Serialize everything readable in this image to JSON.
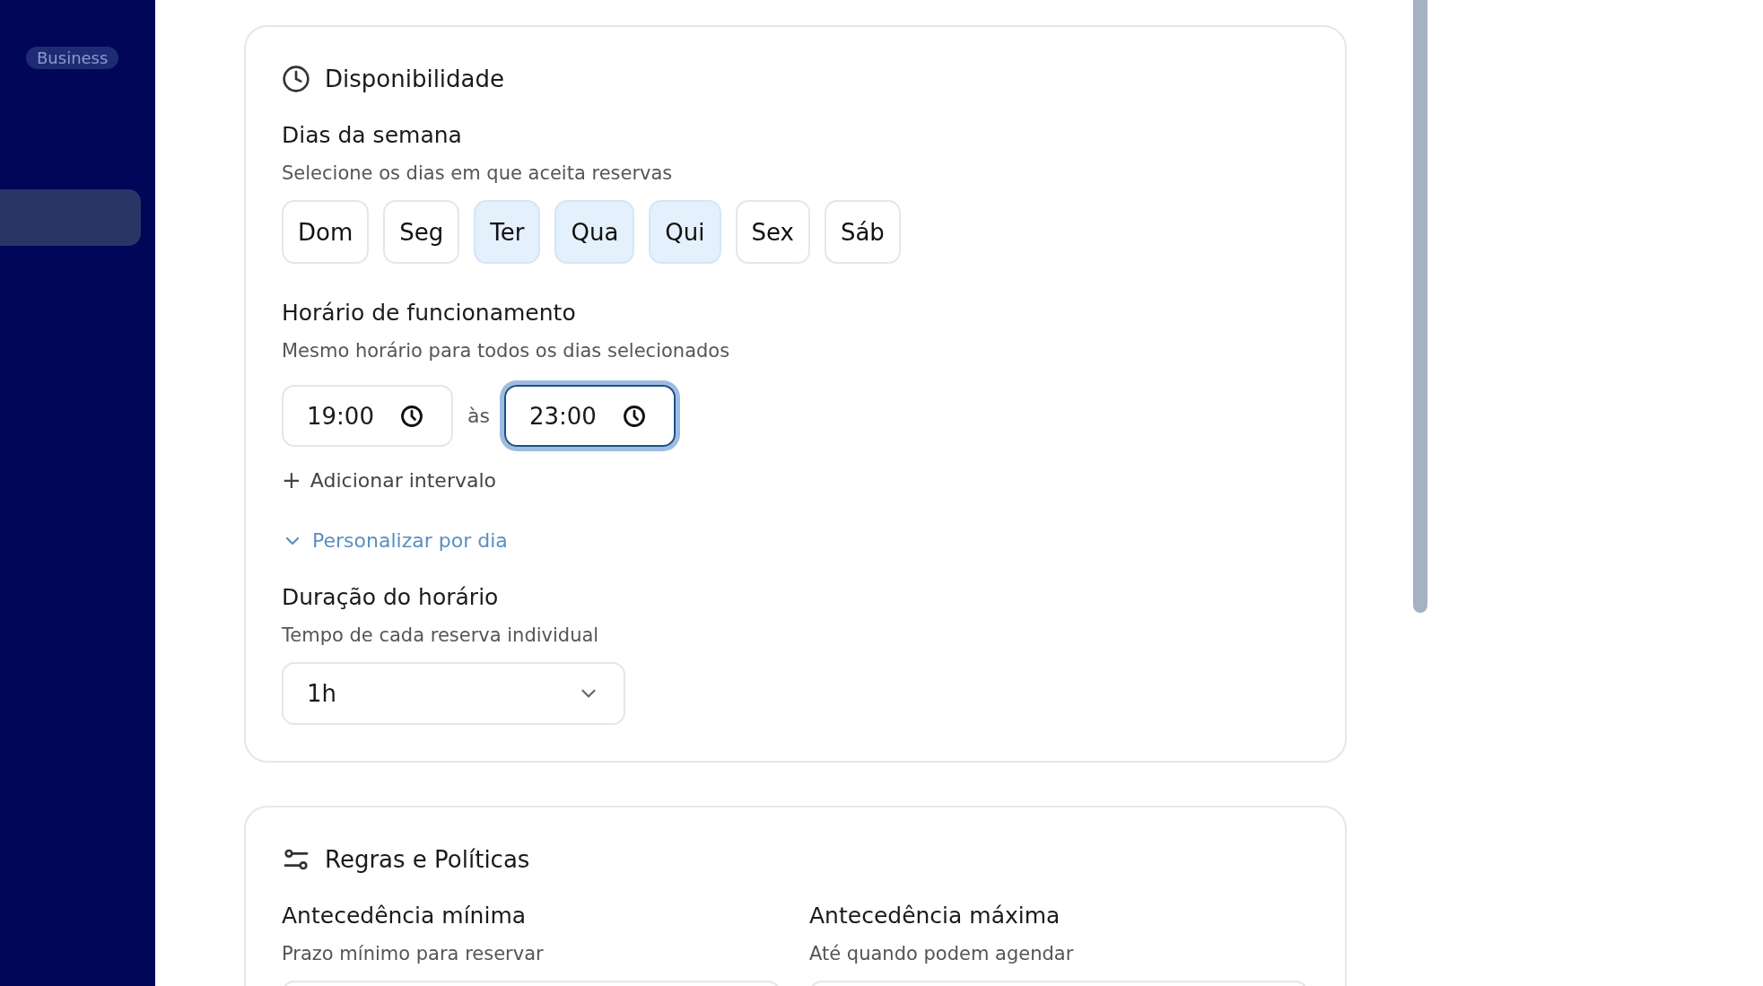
{
  "sidebar": {
    "badge": "Business"
  },
  "availability": {
    "title": "Disponibilidade",
    "days": {
      "label": "Dias da semana",
      "hint": "Selecione os dias em que aceita reservas",
      "items": [
        {
          "label": "Dom",
          "selected": false
        },
        {
          "label": "Seg",
          "selected": false
        },
        {
          "label": "Ter",
          "selected": true
        },
        {
          "label": "Qua",
          "selected": true
        },
        {
          "label": "Qui",
          "selected": true
        },
        {
          "label": "Sex",
          "selected": false
        },
        {
          "label": "Sáb",
          "selected": false
        }
      ]
    },
    "hours": {
      "label": "Horário de funcionamento",
      "hint": "Mesmo horário para todos os dias selecionados",
      "start": {
        "value": "19:00",
        "focused": false
      },
      "separator": "às",
      "end": {
        "value": "23:00",
        "focused": true
      }
    },
    "add_interval": {
      "icon": "+",
      "label": "Adicionar intervalo"
    },
    "customize": {
      "label": "Personalizar por dia",
      "expanded": false
    },
    "duration": {
      "label": "Duração do horário",
      "hint": "Tempo de cada reserva individual",
      "value": "1h"
    }
  },
  "rules": {
    "title": "Regras e Políticas",
    "columns": [
      {
        "label": "Antecedência mínima",
        "hint": "Prazo mínimo para reservar"
      },
      {
        "label": "Antecedência máxima",
        "hint": "Até quando podem agendar"
      }
    ]
  }
}
